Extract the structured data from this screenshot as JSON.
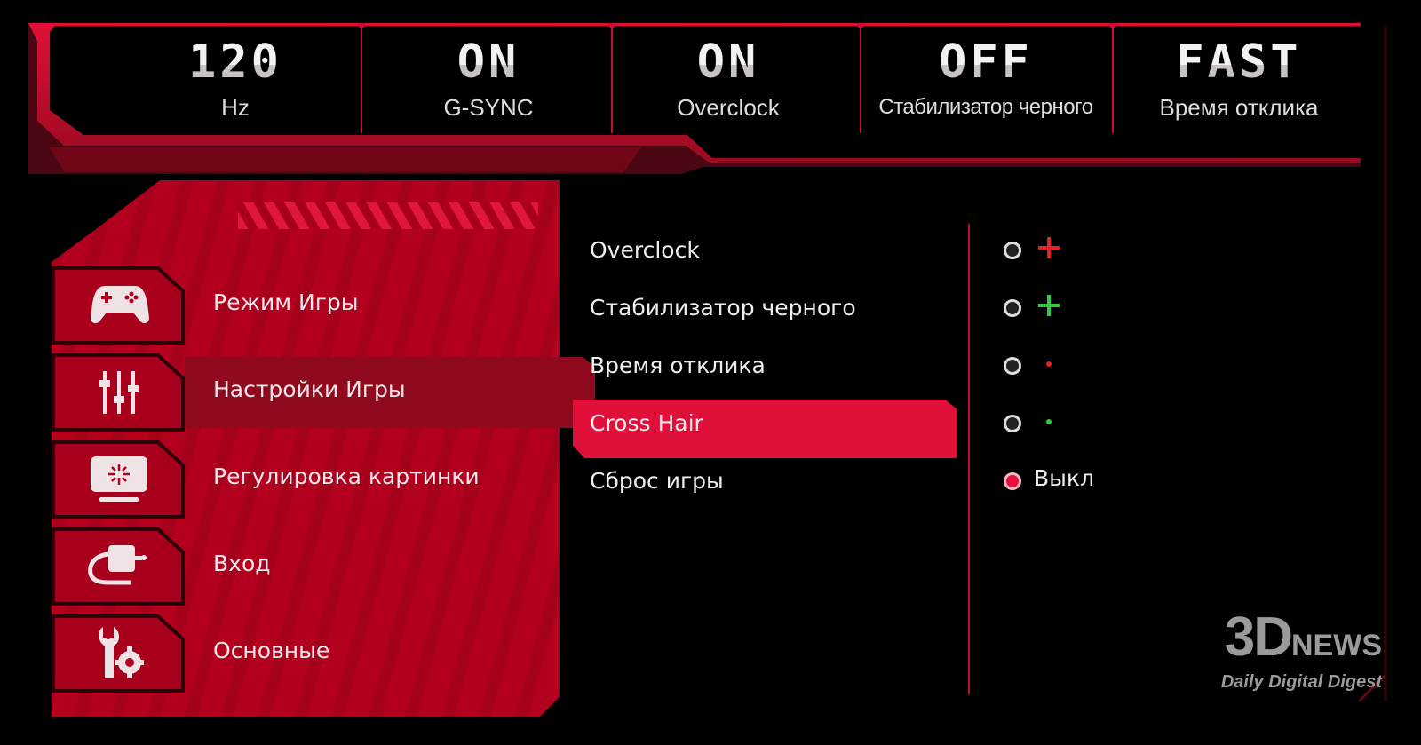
{
  "status_bar": [
    {
      "value": "120",
      "label": "Hz"
    },
    {
      "value": "ON",
      "label": "G-SYNC"
    },
    {
      "value": "ON",
      "label": "Overclock"
    },
    {
      "value": "OFF",
      "label": "Стабилизатор черного"
    },
    {
      "value": "FAST",
      "label": "Время отклика"
    }
  ],
  "sidebar": {
    "items": [
      {
        "label": "Режим Игры",
        "icon": "gamepad-icon",
        "selected": false
      },
      {
        "label": "Настройки Игры",
        "icon": "sliders-icon",
        "selected": true
      },
      {
        "label": "Регулировка картинки",
        "icon": "monitor-brightness-icon",
        "selected": false
      },
      {
        "label": "Вход",
        "icon": "input-plug-icon",
        "selected": false
      },
      {
        "label": "Основные",
        "icon": "wrench-gear-icon",
        "selected": false
      }
    ]
  },
  "submenu": {
    "items": [
      {
        "label": "Overclock",
        "selected": false
      },
      {
        "label": "Стабилизатор черного",
        "selected": false
      },
      {
        "label": "Время отклика",
        "selected": false
      },
      {
        "label": "Cross Hair",
        "selected": true
      },
      {
        "label": "Сброс игры",
        "selected": false
      }
    ]
  },
  "crosshair_options": [
    {
      "type": "large-cross",
      "color": "#e8202c",
      "selected": false
    },
    {
      "type": "large-cross",
      "color": "#2ecc40",
      "selected": false
    },
    {
      "type": "dot",
      "color": "#e8202c",
      "selected": false
    },
    {
      "type": "dot",
      "color": "#2ecc40",
      "selected": false
    },
    {
      "type": "text",
      "label": "Выкл",
      "selected": true
    }
  ],
  "colors": {
    "accent": "#e0103a",
    "panel_red": "#b0001e",
    "selected_dark": "#8f0a1f"
  },
  "watermark": {
    "main": "3D",
    "news": "NEWS",
    "tagline": "Daily Digital Digest"
  }
}
